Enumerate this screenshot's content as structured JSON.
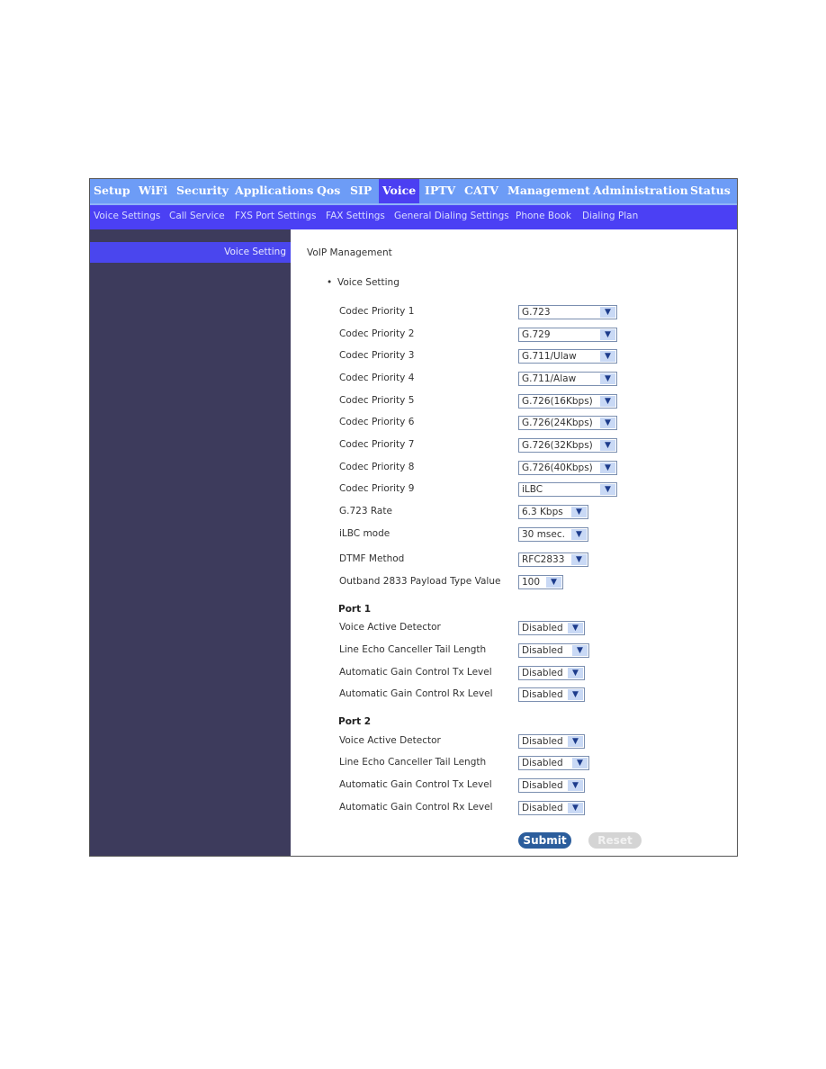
{
  "top_nav": [
    "Setup",
    "WiFi",
    "Security",
    "Applications",
    "Qos",
    "SIP",
    "Voice",
    "IPTV",
    "CATV",
    "Management",
    "Administration",
    "Status"
  ],
  "active_top": "Voice",
  "sub_nav": [
    "Voice Settings",
    "Call Service",
    "FXS Port Settings",
    "FAX Settings",
    "General Dialing Settings",
    "Phone Book",
    "Dialing Plan"
  ],
  "sidebar": {
    "item": "Voice Setting"
  },
  "main": {
    "title": "VoIP Management",
    "section": "Voice Setting",
    "fields": [
      {
        "label": "Codec Priority 1",
        "value": "G.723"
      },
      {
        "label": "Codec Priority 2",
        "value": "G.729"
      },
      {
        "label": "Codec Priority 3",
        "value": "G.711/Ulaw"
      },
      {
        "label": "Codec Priority 4",
        "value": "G.711/Alaw"
      },
      {
        "label": "Codec Priority 5",
        "value": "G.726(16Kbps)"
      },
      {
        "label": "Codec Priority 6",
        "value": "G.726(24Kbps)"
      },
      {
        "label": "Codec Priority 7",
        "value": "G.726(32Kbps)"
      },
      {
        "label": "Codec Priority 8",
        "value": "G.726(40Kbps)"
      },
      {
        "label": "Codec Priority 9",
        "value": "iLBC"
      },
      {
        "label": "G.723 Rate",
        "value": "6.3 Kbps"
      },
      {
        "label": "iLBC mode",
        "value": "30 msec."
      },
      {
        "label": "DTMF Method",
        "value": "RFC2833"
      },
      {
        "label": "Outband 2833 Payload Type Value",
        "value": "100"
      }
    ],
    "ports": [
      {
        "title": "Port 1",
        "fields": [
          {
            "label": "Voice Active Detector",
            "value": "Disabled"
          },
          {
            "label": "Line Echo Canceller Tail Length",
            "value": "Disabled"
          },
          {
            "label": "Automatic Gain Control Tx Level",
            "value": "Disabled"
          },
          {
            "label": "Automatic Gain Control Rx Level",
            "value": "Disabled"
          }
        ]
      },
      {
        "title": "Port 2",
        "fields": [
          {
            "label": "Voice Active Detector",
            "value": "Disabled"
          },
          {
            "label": "Line Echo Canceller Tail Length",
            "value": "Disabled"
          },
          {
            "label": "Automatic Gain Control Tx Level",
            "value": "Disabled"
          },
          {
            "label": "Automatic Gain Control Rx Level",
            "value": "Disabled"
          }
        ]
      }
    ],
    "submit": "Submit",
    "reset": "Reset"
  },
  "colors": {
    "top_nav": "#6d9cf6",
    "sub_nav": "#4b40f4",
    "sidebar": "#3d3b5c",
    "submit": "#2b5d9c"
  }
}
